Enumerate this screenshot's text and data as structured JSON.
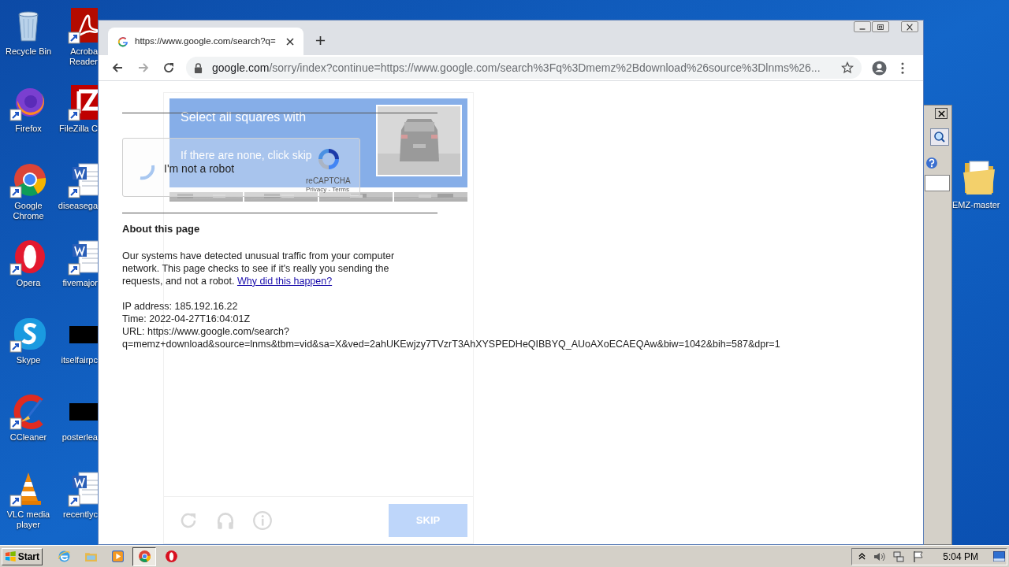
{
  "desktop": {
    "column_1": [
      {
        "label": "Recycle Bin",
        "kind": "recycle"
      },
      {
        "label": "Firefox",
        "kind": "firefox"
      },
      {
        "label": "Google Chrome",
        "kind": "chrome"
      },
      {
        "label": "Opera",
        "kind": "opera"
      },
      {
        "label": "Skype",
        "kind": "skype"
      },
      {
        "label": "CCleaner",
        "kind": "ccleaner"
      },
      {
        "label": "VLC media player",
        "kind": "vlc"
      }
    ],
    "column_2": [
      {
        "label": "Acroba Reader",
        "kind": "pdf"
      },
      {
        "label": "FileZilla C",
        "kind": "filezilla"
      },
      {
        "label": "diseasega",
        "kind": "word"
      },
      {
        "label": "fivemajor",
        "kind": "word"
      },
      {
        "label": "itselfairpc",
        "kind": "blank"
      },
      {
        "label": "posterlea",
        "kind": "blank"
      },
      {
        "label": "recentlyc",
        "kind": "word"
      }
    ],
    "right_folder": {
      "label": "EMZ-master"
    }
  },
  "browser": {
    "tab": {
      "title": "https://www.google.com/search?q="
    },
    "address": {
      "host": "google.com",
      "rest": "/sorry/index?continue=https://www.google.com/search%3Fq%3Dmemz%2Bdownload%26source%3Dlnms%26..."
    },
    "page": {
      "checkbox_label": "I'm not a robot",
      "recaptcha_brand": "reCAPTCHA",
      "recaptcha_links": "Privacy - Terms",
      "heading": "About this page",
      "paragraph": "Our systems have detected unusual traffic from your computer network. This page checks to see if it's really you sending the requests, and not a robot.",
      "link": "Why did this happen?",
      "info_lines": [
        "IP address: 185.192.16.22",
        "Time: 2022-04-27T16:04:01Z",
        "URL: https://www.google.com/search?",
        "q=memz+download&source=lnms&tbm=vid&sa=X&ved=2ahUKEwjzy7TVzrT3AhXYSPEDHeQIBBYQ_AUoAXoECAEQAw&biw=1042&bih=587&dpr=1"
      ]
    },
    "challenge": {
      "title": "Select all squares with",
      "subtitle": "If there are none, click skip",
      "skip": "SKIP"
    }
  },
  "taskbar": {
    "start": "Start",
    "apps": [
      {
        "kind": "ie",
        "selected": false
      },
      {
        "kind": "explorer",
        "selected": false
      },
      {
        "kind": "media",
        "selected": false
      },
      {
        "kind": "chrome",
        "selected": true
      },
      {
        "kind": "opera",
        "selected": false
      }
    ],
    "clock": "5:04 PM"
  }
}
